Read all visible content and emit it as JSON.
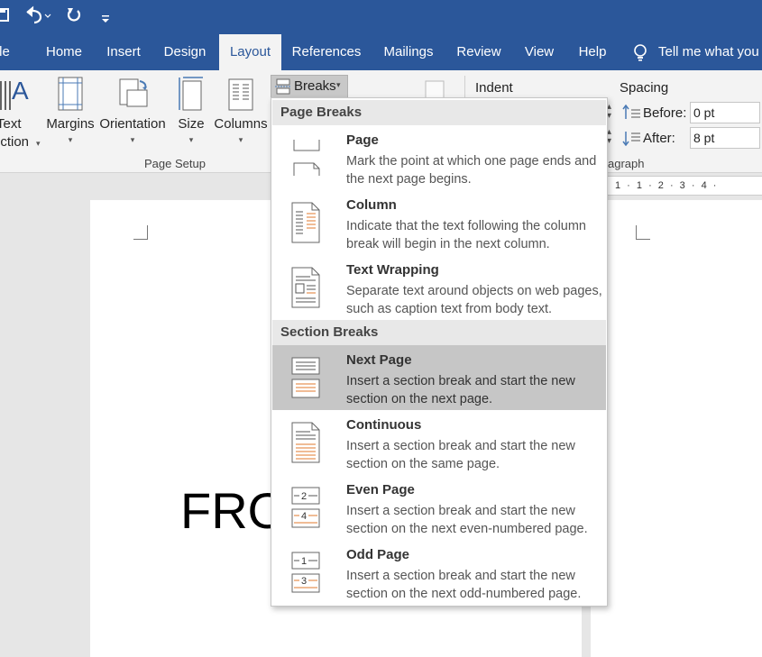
{
  "titlebar": {
    "qat": [
      "save-icon",
      "undo-icon",
      "redo-icon",
      "customize-icon"
    ]
  },
  "tabs": [
    {
      "label": "le",
      "active": false
    },
    {
      "label": "Home",
      "active": false
    },
    {
      "label": "Insert",
      "active": false
    },
    {
      "label": "Design",
      "active": false
    },
    {
      "label": "Layout",
      "active": true
    },
    {
      "label": "References",
      "active": false
    },
    {
      "label": "Mailings",
      "active": false
    },
    {
      "label": "Review",
      "active": false
    },
    {
      "label": "View",
      "active": false
    },
    {
      "label": "Help",
      "active": false
    }
  ],
  "tell_me": "Tell me what you",
  "ribbon": {
    "text_direction": {
      "line1": "Text",
      "line2": "ection"
    },
    "margins": "Margins",
    "orientation": "Orientation",
    "size": "Size",
    "columns": "Columns",
    "breaks": "Breaks",
    "page_setup_label": "Page Setup",
    "indent_label": "Indent",
    "spacing_label": "Spacing",
    "before_label": "Before:",
    "before_value": "0 pt",
    "after_label": "After:",
    "after_value": "8 pt",
    "paragraph_label": "agraph"
  },
  "document": {
    "big_text": "FRO",
    "ruler_text": "1 · 1 · 2 · 3 · 4 ·"
  },
  "breaks_menu": {
    "page_breaks_header": "Page Breaks",
    "section_breaks_header": "Section Breaks",
    "items": [
      {
        "title": "Page",
        "desc": "Mark the point at which one page ends and the next page begins.",
        "icon": "page-break-icon"
      },
      {
        "title": "Column",
        "desc": "Indicate that the text following the column break will begin in the next column.",
        "icon": "column-break-icon"
      },
      {
        "title": "Text Wrapping",
        "desc": "Separate text around objects on web pages, such as caption text from body text.",
        "icon": "text-wrapping-break-icon"
      },
      {
        "title": "Next Page",
        "desc": "Insert a section break and start the new section on the next page.",
        "icon": "next-page-break-icon"
      },
      {
        "title": "Continuous",
        "desc": "Insert a section break and start the new section on the same page.",
        "icon": "continuous-break-icon"
      },
      {
        "title": "Even Page",
        "desc": "Insert a section break and start the new section on the next even-numbered page.",
        "icon": "even-page-break-icon"
      },
      {
        "title": "Odd Page",
        "desc": "Insert a section break and start the new section on the next odd-numbered page.",
        "icon": "odd-page-break-icon"
      }
    ]
  },
  "colors": {
    "brand": "#2b579a",
    "ribbon": "#f3f3f3",
    "selected_item": "#c6c6c6",
    "icon_accent": "#e07a2e"
  }
}
